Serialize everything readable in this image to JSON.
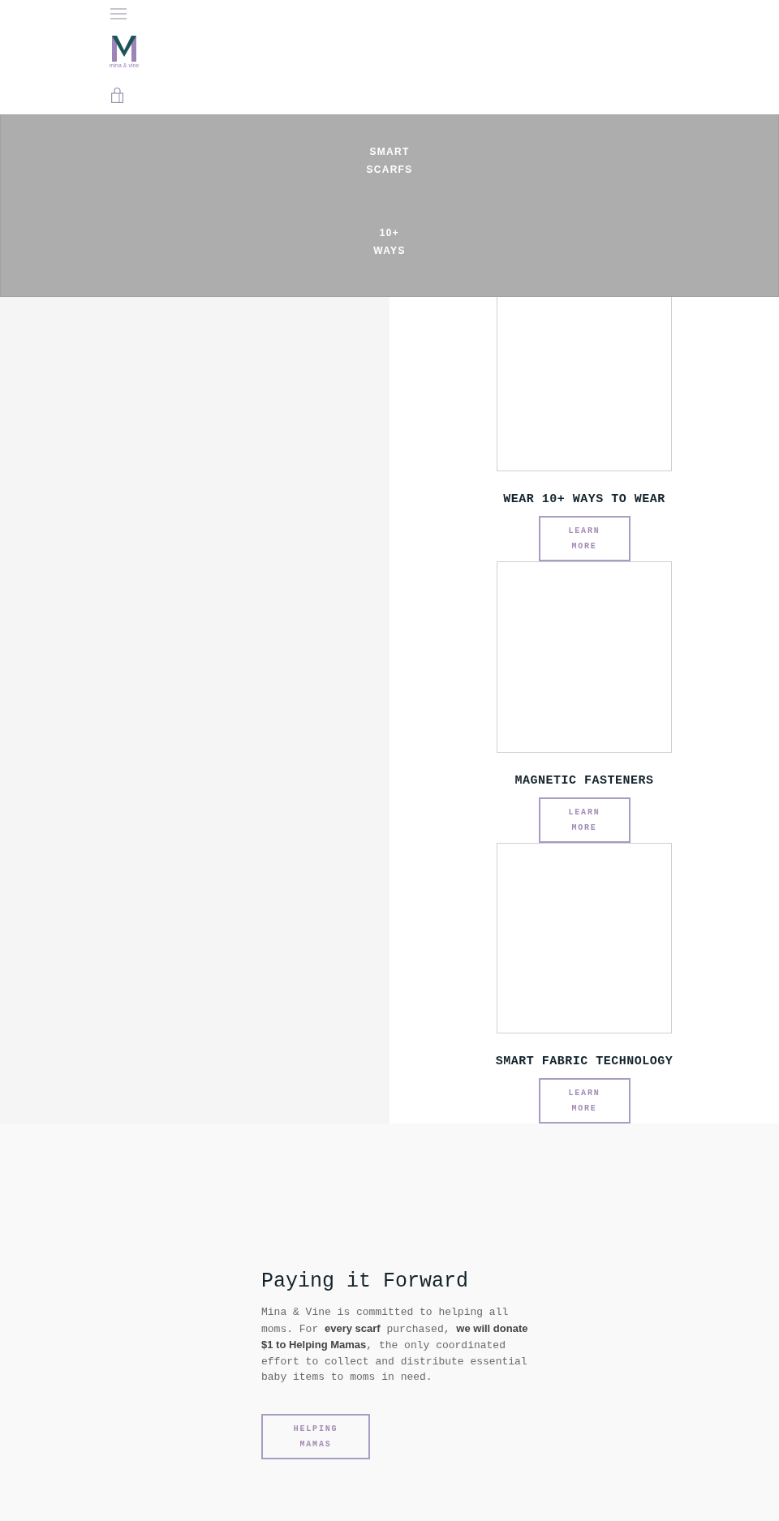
{
  "header": {
    "logo_text": "mina & vine"
  },
  "hero": {
    "lines": [
      "SMART SCARFS",
      "10+ WAYS"
    ]
  },
  "features": [
    {
      "heading": "WEAR 10+ WAYS TO WEAR",
      "button": "LEARN MORE"
    },
    {
      "heading": "MAGNETIC FASTENERS",
      "button": "LEARN MORE"
    },
    {
      "heading": "SMART FABRIC TECHNOLOGY",
      "button": "LEARN MORE"
    }
  ],
  "mission": {
    "title": "Paying it Forward",
    "text": "Mina & Vine is committed to helping all moms. For **every scarf** purchased, **we will donate $1 to Helping Mamas**, the only coordinated effort to collect and distribute essential baby items to moms in need.",
    "button": "HELPING MAMAS"
  }
}
